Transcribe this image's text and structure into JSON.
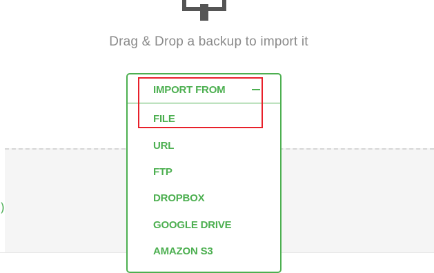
{
  "drop_zone": {
    "message": "Drag & Drop a backup to import it",
    "icon": "upload-icon"
  },
  "import_menu": {
    "header_label": "IMPORT FROM",
    "collapse_icon": "minus-icon",
    "items": [
      {
        "label": "FILE"
      },
      {
        "label": "URL"
      },
      {
        "label": "FTP"
      },
      {
        "label": "DROPBOX"
      },
      {
        "label": "GOOGLE DRIVE"
      },
      {
        "label": "AMAZON S3"
      }
    ]
  },
  "colors": {
    "accent": "#4caf50",
    "highlight": "#e8202a",
    "muted_text": "#8a8a8a"
  }
}
